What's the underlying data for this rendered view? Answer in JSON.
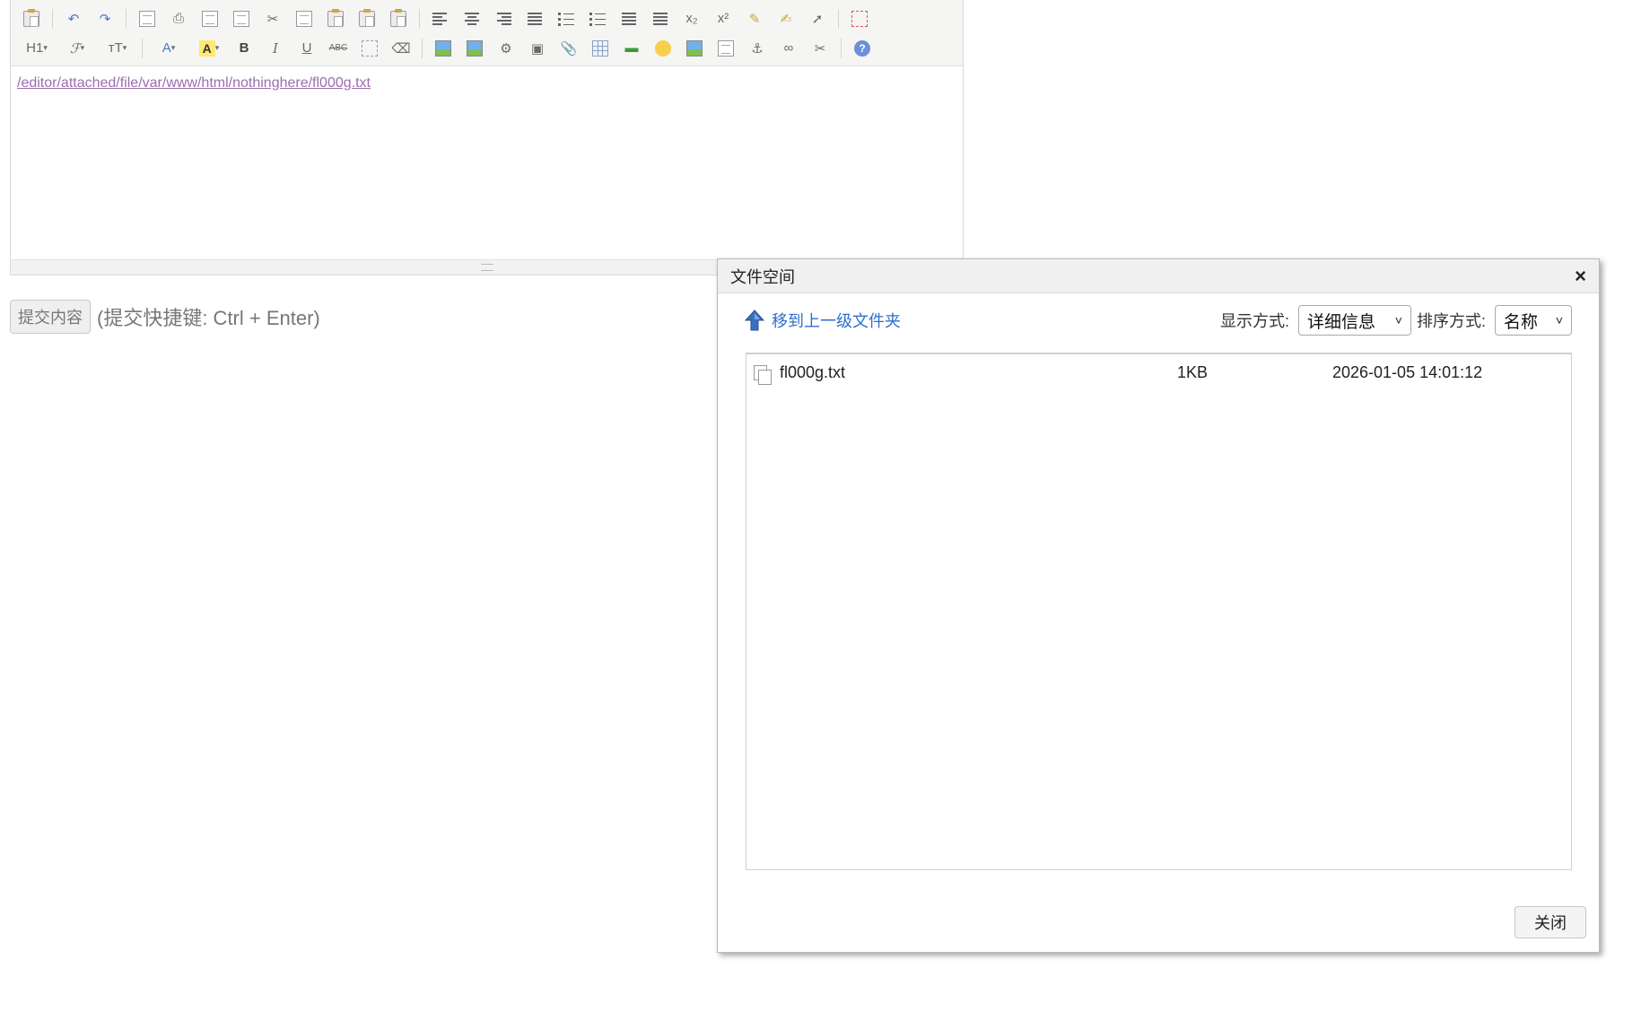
{
  "editor": {
    "content_link": "/editor/attached/file/var/www/html/nothinghere/fl000g.txt",
    "toolbar_labels": {
      "heading": "H1",
      "font": "𝓕",
      "size": "ᴛT",
      "bold": "B",
      "italic": "I",
      "underline": "U",
      "strike": "ABC",
      "subscript": "x₂",
      "superscript": "x²",
      "forecolor": "A",
      "hilite": "A"
    }
  },
  "submit": {
    "button_label": "提交内容",
    "hint": "(提交快捷键: Ctrl + Enter)"
  },
  "dialog": {
    "title": "文件空间",
    "close_symbol": "×",
    "up_label": "移到上一级文件夹",
    "view_label": "显示方式:",
    "view_value": "详细信息",
    "sort_label": "排序方式:",
    "sort_value": "名称",
    "files": [
      {
        "name": "fl000g.txt",
        "size": "1KB",
        "date": "2026-01-05 14:01:12"
      }
    ],
    "close_button": "关闭"
  },
  "icons": {
    "chevron": "˅"
  }
}
